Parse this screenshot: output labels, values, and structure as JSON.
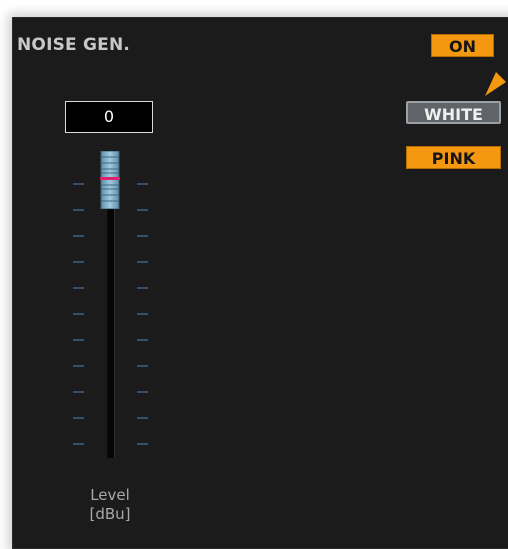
{
  "panel": {
    "title": "NOISE GEN."
  },
  "buttons": {
    "on_label": "ON",
    "white_label": "WHITE",
    "pink_label": "PINK"
  },
  "fader": {
    "value": "0",
    "label_line1": "Level",
    "label_line2": "[dBu]"
  },
  "icons": {
    "knob": "fader-knob-icon",
    "hint": "arrow-pointer-icon"
  },
  "colors": {
    "panel_bg": "#1b1b1b",
    "accent_orange": "#f3980f",
    "selected_gray": "#606468",
    "knob_blue": "#7fb2cc",
    "knob_marker": "#e0206e",
    "tick_blue": "#35506b"
  }
}
